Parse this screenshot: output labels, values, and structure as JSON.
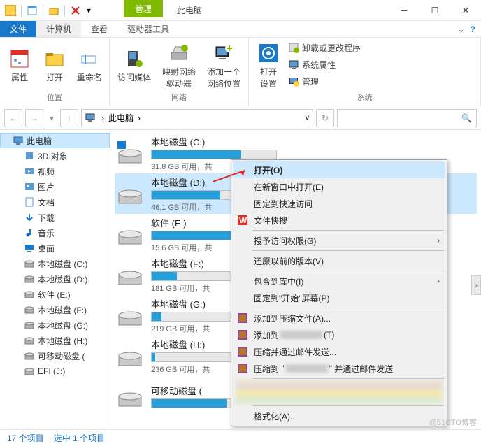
{
  "titlebar": {
    "context_tab": "管理",
    "title": "此电脑"
  },
  "ribbon_tabs": {
    "file": "文件",
    "computer": "计算机",
    "view": "查看",
    "drive_tools": "驱动器工具"
  },
  "ribbon": {
    "group_location": {
      "label": "位置",
      "properties": "属性",
      "open": "打开",
      "rename": "重命名"
    },
    "group_network": {
      "label": "网络",
      "access_media": "访问媒体",
      "map_drive": "映射网络\n驱动器",
      "add_location": "添加一个\n网络位置"
    },
    "group_system": {
      "label": "系统",
      "open_settings": "打开\n设置",
      "uninstall": "卸载或更改程序",
      "sys_props": "系统属性",
      "manage": "管理"
    }
  },
  "nav": {
    "location": "此电脑",
    "chevron": "›"
  },
  "tree": {
    "this_pc": "此电脑",
    "items": [
      {
        "label": "3D 对象"
      },
      {
        "label": "视频"
      },
      {
        "label": "图片"
      },
      {
        "label": "文档"
      },
      {
        "label": "下载"
      },
      {
        "label": "音乐"
      },
      {
        "label": "桌面"
      },
      {
        "label": "本地磁盘 (C:)"
      },
      {
        "label": "本地磁盘 (D:)"
      },
      {
        "label": "软件 (E:)"
      },
      {
        "label": "本地磁盘 (F:)"
      },
      {
        "label": "本地磁盘 (G:)"
      },
      {
        "label": "本地磁盘 (H:)"
      },
      {
        "label": "可移动磁盘 ("
      },
      {
        "label": "EFI (J:)"
      }
    ]
  },
  "drives": [
    {
      "name": "本地磁盘 (C:)",
      "free": "31.8 GB 可用，共",
      "fill": 72,
      "os": true
    },
    {
      "name": "本地磁盘 (D:)",
      "free": "46.1 GB 可用，共",
      "fill": 55,
      "selected": true
    },
    {
      "name": "软件 (E:)",
      "free": "15.6 GB 可用，共",
      "fill": 86
    },
    {
      "name": "本地磁盘 (F:)",
      "free": "181 GB 可用，共",
      "fill": 20
    },
    {
      "name": "本地磁盘 (G:)",
      "free": "219 GB 可用，共",
      "fill": 8
    },
    {
      "name": "本地磁盘 (H:)",
      "free": "236 GB 可用，共",
      "fill": 3
    },
    {
      "name": "可移动磁盘 (",
      "free": "",
      "fill": 60
    }
  ],
  "menu": {
    "open": "打开(O)",
    "open_new": "在新窗口中打开(E)",
    "pin_quick": "固定到快速访问",
    "wps": "文件快搜",
    "grant": "授予访问权限(G)",
    "restore": "还原以前的版本(V)",
    "include": "包含到库中(I)",
    "pin_start": "固定到\"开始\"屏幕(P)",
    "add_archive": "添加到压缩文件(A)...",
    "add_to": "添加到",
    "add_to_suffix": "(T)",
    "compress_mail": "压缩并通过邮件发送...",
    "compress_to": "压缩到",
    "compress_suffix": "并通过邮件发送",
    "format": "格式化(A)..."
  },
  "status": {
    "count": "17 个项目",
    "selected": "选中 1 个项目"
  },
  "watermark": "@51CTO博客"
}
